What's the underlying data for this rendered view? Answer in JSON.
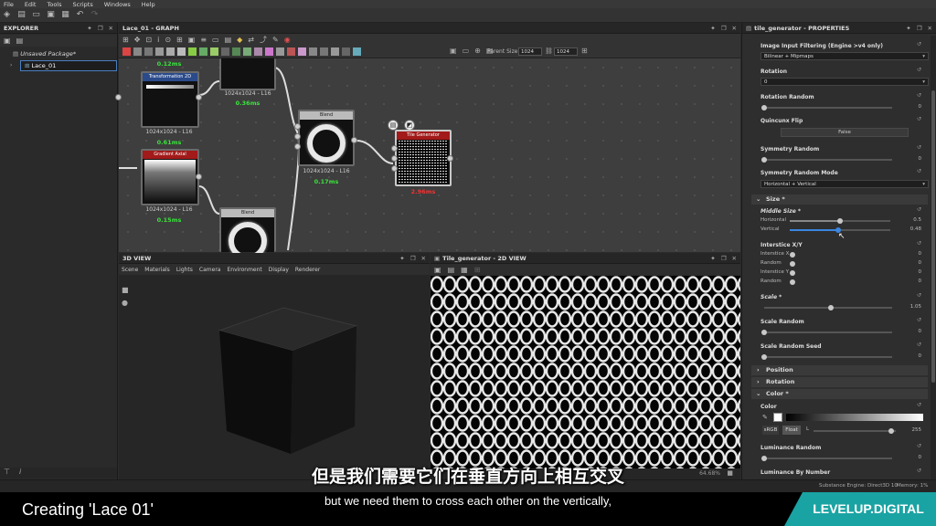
{
  "menu": [
    "File",
    "Edit",
    "Tools",
    "Scripts",
    "Windows",
    "Help"
  ],
  "explorer": {
    "title": "EXPLORER",
    "package": "Unsaved Package*",
    "item": "Lace_01"
  },
  "graph": {
    "title": "Lace_01 - GRAPH",
    "parent_size_label": "Parent Size:",
    "parent_size": "1024",
    "size": "1024",
    "nodes": {
      "top": {
        "label": "1024x1024 - L16",
        "time": "0.12ms"
      },
      "mid_top": {
        "label": "1024x1024 - L16",
        "time": "0.36ms"
      },
      "transform": {
        "title": "Transformation 2D",
        "label": "1024x1024 - L16",
        "time": "0.61ms"
      },
      "gradient": {
        "title": "Gradient Axial",
        "label": "1024x1024 - L16",
        "time": "0.15ms"
      },
      "blend1": {
        "title": "Blend",
        "label": "1024x1024 - L16",
        "time": "0.17ms"
      },
      "blend2": {
        "title": "Blend"
      },
      "tile": {
        "title": "Tile Generator",
        "time": "2.96ms"
      }
    }
  },
  "view3d": {
    "title": "3D VIEW",
    "menu": [
      "Scene",
      "Materials",
      "Lights",
      "Camera",
      "Environment",
      "Display",
      "Renderer"
    ]
  },
  "view2d": {
    "title": "Tile_generator - 2D VIEW",
    "zoom": "64.68%"
  },
  "props": {
    "title": "tile_generator - PROPERTIES",
    "filtering_label": "Image Input Filtering (Engine >v4 only)",
    "filtering_value": "Bilinear + Mipmaps",
    "rotation_label": "Rotation",
    "rotation_value": "0",
    "rotation_random_label": "Rotation Random",
    "rotation_random_value": "0",
    "quincunx_label": "Quincunx Flip",
    "quincunx_value": "False",
    "sym_random_label": "Symmetry Random",
    "sym_random_value": "0",
    "sym_mode_label": "Symmetry Random Mode",
    "sym_mode_value": "Horizontal + Vertical",
    "size_section": "Size *",
    "middle_size_label": "Middle Size *",
    "horizontal_label": "Horizontal",
    "horizontal_value": "0.5",
    "vertical_label": "Vertical",
    "vertical_value": "0.48",
    "interstice_label": "Interstice X/Y",
    "interstice_x_label": "Interstice X",
    "interstice_x_value": "0",
    "random1_label": "Random",
    "random1_value": "0",
    "interstice_y_label": "Interstice Y",
    "interstice_y_value": "0",
    "random2_label": "Random",
    "random2_value": "0",
    "scale_label": "Scale *",
    "scale_value": "1.05",
    "scale_random_label": "Scale Random",
    "scale_random_value": "0",
    "scale_seed_label": "Scale Random Seed",
    "scale_seed_value": "0",
    "position_section": "Position",
    "rotation_section": "Rotation",
    "color_section": "Color *",
    "color_label": "Color",
    "srgb": "sRGB",
    "float": "Float",
    "l_label": "L",
    "color_value": "255",
    "lum_random_label": "Luminance Random",
    "lum_random_value": "0",
    "lum_number_label": "Luminance By Number"
  },
  "status": {
    "engine": "Substance Engine: Direct3D 10",
    "memory": "Memory: 1%"
  },
  "subtitle": {
    "zh": "但是我们需要它们在垂直方向上相互交叉",
    "en": "but we need them to cross each other on the vertically,"
  },
  "course_title": "Creating 'Lace 01'",
  "brand": "LEVELUP.DIGITAL"
}
